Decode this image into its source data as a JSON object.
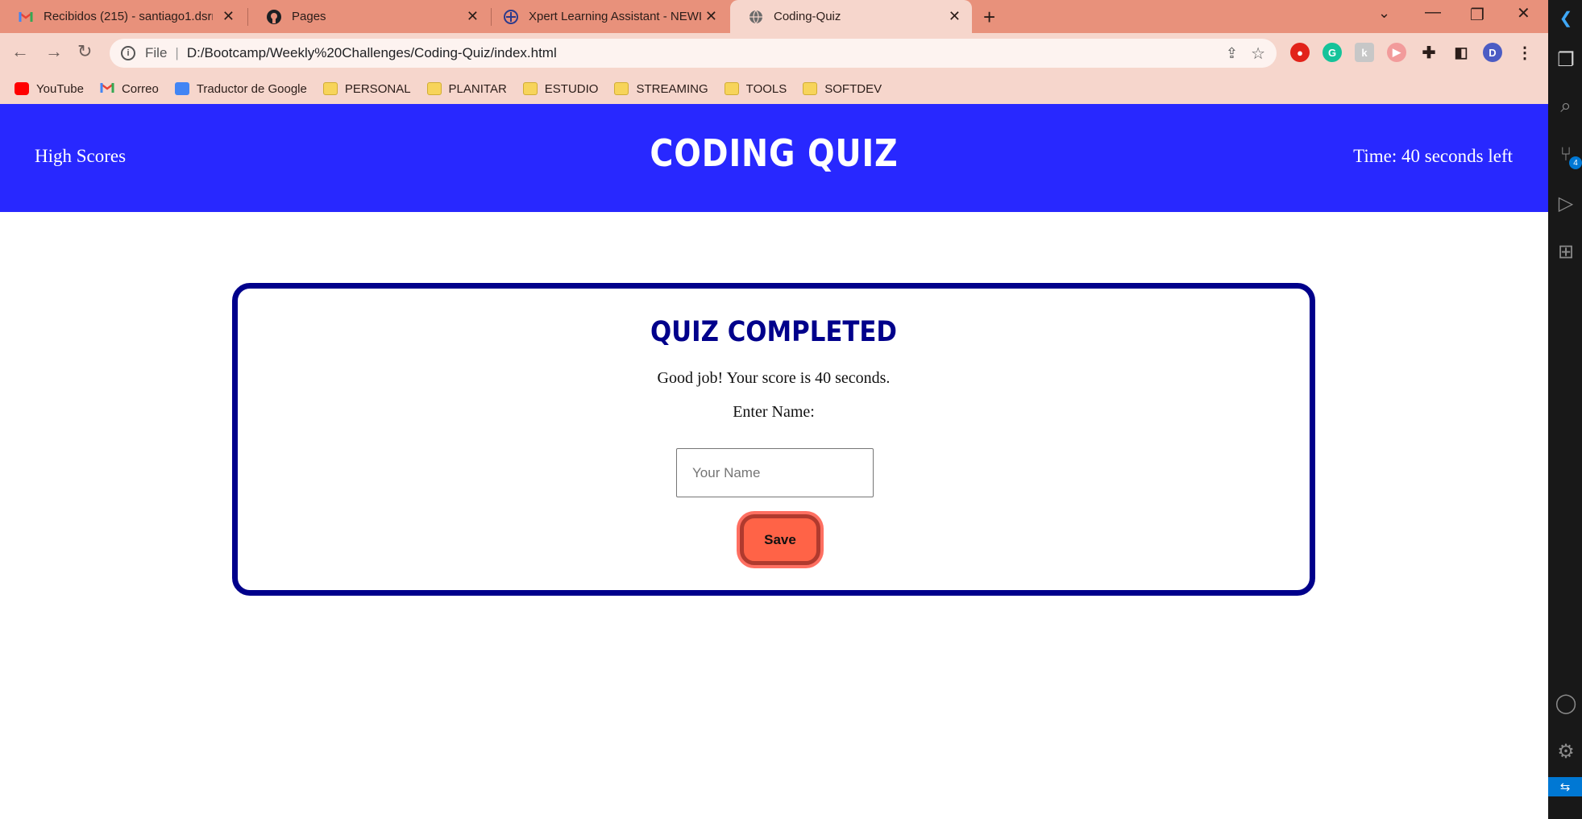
{
  "browser": {
    "tabs": [
      {
        "label": "Recibidos (215) - santiago1.dsrm",
        "icon": "gmail-icon"
      },
      {
        "label": "Pages",
        "icon": "github-icon"
      },
      {
        "label": "Xpert Learning Assistant - NEWI",
        "icon": "xpert-icon"
      },
      {
        "label": "Coding-Quiz",
        "icon": "globe-icon",
        "active": true
      }
    ],
    "address": {
      "scheme_label": "File",
      "url": "D:/Bootcamp/Weekly%20Challenges/Coding-Quiz/index.html"
    },
    "profile_initial": "D",
    "bookmarks": [
      {
        "label": "YouTube",
        "icon": "youtube-icon"
      },
      {
        "label": "Correo",
        "icon": "gmail-icon"
      },
      {
        "label": "Traductor de Google",
        "icon": "translate-icon"
      },
      {
        "label": "PERSONAL",
        "icon": "folder-icon"
      },
      {
        "label": "PLANITAR",
        "icon": "folder-icon"
      },
      {
        "label": "ESTUDIO",
        "icon": "folder-icon"
      },
      {
        "label": "STREAMING",
        "icon": "folder-icon"
      },
      {
        "label": "TOOLS",
        "icon": "folder-icon"
      },
      {
        "label": "SOFTDEV",
        "icon": "folder-icon"
      }
    ]
  },
  "header": {
    "high_scores_link": "High Scores",
    "title": "CODING QUIZ",
    "timer": "Time: 40 seconds left"
  },
  "result": {
    "title": "QUIZ COMPLETED",
    "score_text": "Good job! Your score is 40 seconds.",
    "name_label": "Enter Name:",
    "name_placeholder": "Your Name",
    "save_label": "Save"
  },
  "vscode": {
    "scm_badge": "4"
  },
  "colors": {
    "header_bg": "#2828ff",
    "card_border": "#00008b",
    "save_button": "#ff6347",
    "tabstrip": "#e8917b",
    "toolbar": "#f6d6cc"
  }
}
